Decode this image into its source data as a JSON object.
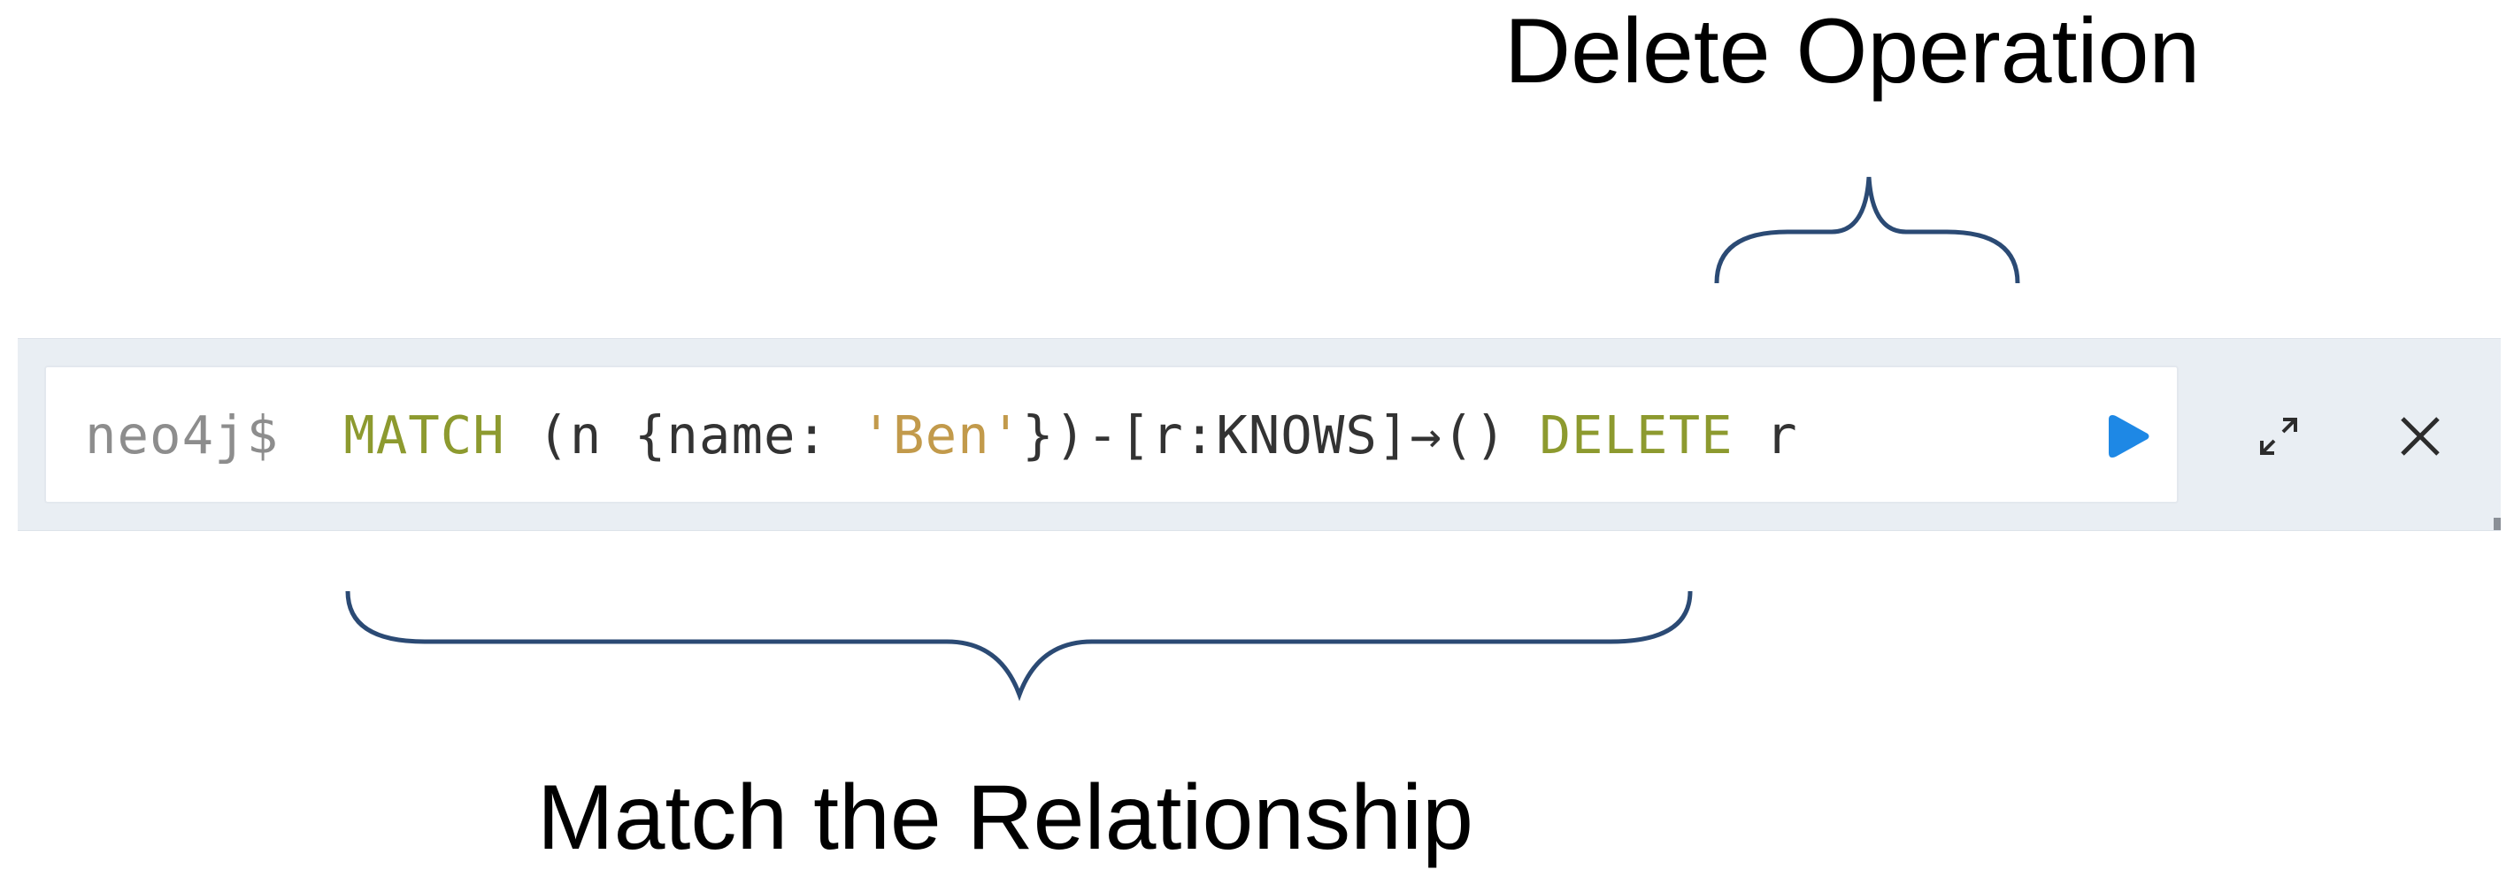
{
  "annotations": {
    "delete_label": "Delete Operation",
    "match_label": "Match the Relationship"
  },
  "editor": {
    "prompt": "neo4j$",
    "tokens": {
      "match_kw": "MATCH",
      "part1": " (n {name: ",
      "string": "'Ben'",
      "part2": "})-[r:KNOWS]→() ",
      "delete_kw": "DELETE",
      "part3": " r"
    }
  },
  "buttons": {
    "run": "play-icon",
    "expand": "expand-icon",
    "close": "close-icon"
  },
  "colors": {
    "keyword": "#8d9a2f",
    "string": "#c29a4b",
    "prompt": "#8d8d8d",
    "run_accent": "#1e88e5",
    "brace": "#2b4a74"
  }
}
